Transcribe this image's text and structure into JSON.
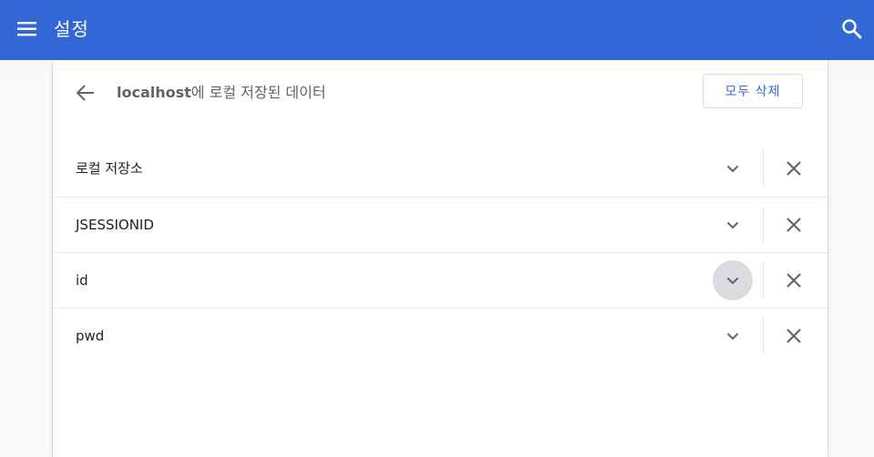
{
  "header": {
    "title": "설정",
    "menu_icon": "hamburger-menu-icon",
    "search_icon": "search-icon",
    "background_color": "#3367d6"
  },
  "page": {
    "back_icon": "arrow-left-icon",
    "heading_host": "localhost",
    "heading_rest": "에 로컬 저장된 데이터",
    "remove_all_label": "모두 삭제"
  },
  "items": [
    {
      "label": "로컬 저장소"
    },
    {
      "label": "JSESSIONID"
    },
    {
      "label": "id"
    },
    {
      "label": "pwd"
    }
  ],
  "colors": {
    "accent": "#3367d6",
    "text_primary": "#202124",
    "text_secondary": "#5f6368",
    "divider": "#e8eaed",
    "hover_circle": "#dadce0"
  }
}
